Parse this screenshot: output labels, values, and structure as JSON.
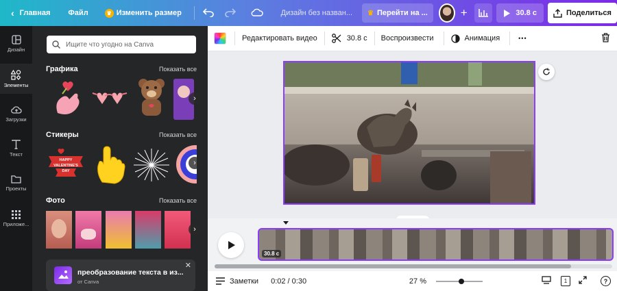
{
  "topbar": {
    "home_label": "Главная",
    "file_label": "Файл",
    "resize_label": "Изменить размер",
    "design_title": "Дизайн без назван...",
    "upgrade_label": "Перейти на ...",
    "play_duration": "30.8 с",
    "share_label": "Поделиться"
  },
  "nav": {
    "items": [
      {
        "label": "Дизайн",
        "icon": "layout-icon"
      },
      {
        "label": "Элементы",
        "icon": "shapes-icon"
      },
      {
        "label": "Загрузки",
        "icon": "upload-cloud-icon"
      },
      {
        "label": "Текст",
        "icon": "text-icon"
      },
      {
        "label": "Проекты",
        "icon": "folder-icon"
      },
      {
        "label": "Приложе...",
        "icon": "apps-icon"
      }
    ]
  },
  "panel": {
    "search_placeholder": "Ищите что угодно на Canva",
    "graphics_title": "Графика",
    "stickers_title": "Стикеры",
    "photos_title": "Фото",
    "show_all": "Показать все",
    "sticker_text": "HAPPY VALENTINE'S DAY",
    "promo_title": "преобразование текста в из...",
    "promo_sub": "от Canva"
  },
  "toolbar": {
    "edit_video": "Редактировать видео",
    "duration": "30.8 с",
    "play": "Воспроизвести",
    "animation": "Анимация",
    "more": "•••"
  },
  "timeline": {
    "clip_duration": "30.8 с"
  },
  "bottombar": {
    "notes": "Заметки",
    "time": "0:02 / 0:30",
    "zoom": "27 %",
    "zoom_fraction": 0.55,
    "page_count": "1",
    "help": "?"
  },
  "colors": {
    "accent": "#8b3dff",
    "panel_bg": "#252627",
    "nav_bg": "#18191b"
  }
}
